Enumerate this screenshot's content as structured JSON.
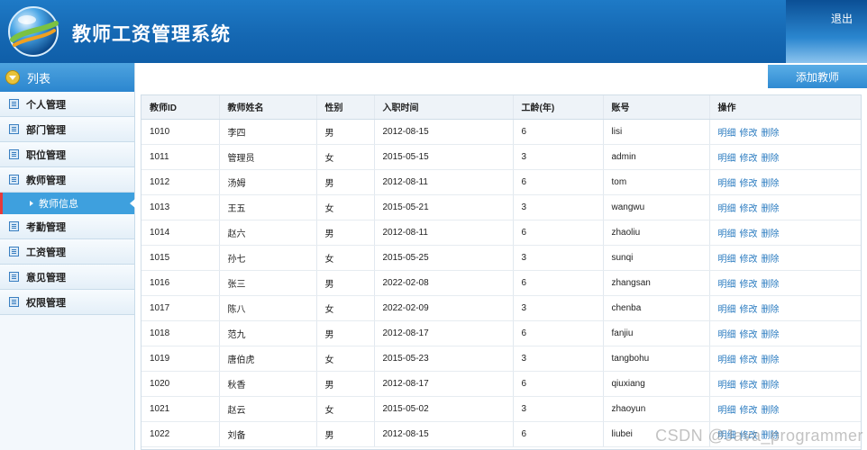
{
  "header": {
    "title": "教师工资管理系统",
    "logout_label": "退出",
    "logo_icon": "globe-logo-icon"
  },
  "sidebar": {
    "header_label": "列表",
    "items": [
      {
        "label": "个人管理"
      },
      {
        "label": "部门管理"
      },
      {
        "label": "职位管理"
      },
      {
        "label": "教师管理",
        "sub": [
          {
            "label": "教师信息",
            "active": true
          }
        ]
      },
      {
        "label": "考勤管理"
      },
      {
        "label": "工资管理"
      },
      {
        "label": "意见管理"
      },
      {
        "label": "权限管理"
      }
    ]
  },
  "toolbar": {
    "add_label": "添加教师"
  },
  "table": {
    "columns": [
      "教师ID",
      "教师姓名",
      "性别",
      "入职时间",
      "工龄(年)",
      "账号",
      "操作"
    ],
    "actions": [
      "明细",
      "修改",
      "删除"
    ],
    "rows": [
      [
        "1010",
        "李四",
        "男",
        "2012-08-15",
        "6",
        "lisi"
      ],
      [
        "1011",
        "管理员",
        "女",
        "2015-05-15",
        "3",
        "admin"
      ],
      [
        "1012",
        "汤姆",
        "男",
        "2012-08-11",
        "6",
        "tom"
      ],
      [
        "1013",
        "王五",
        "女",
        "2015-05-21",
        "3",
        "wangwu"
      ],
      [
        "1014",
        "赵六",
        "男",
        "2012-08-11",
        "6",
        "zhaoliu"
      ],
      [
        "1015",
        "孙七",
        "女",
        "2015-05-25",
        "3",
        "sunqi"
      ],
      [
        "1016",
        "张三",
        "男",
        "2022-02-08",
        "6",
        "zhangsan"
      ],
      [
        "1017",
        "陈八",
        "女",
        "2022-02-09",
        "3",
        "chenba"
      ],
      [
        "1018",
        "范九",
        "男",
        "2012-08-17",
        "6",
        "fanjiu"
      ],
      [
        "1019",
        "唐伯虎",
        "女",
        "2015-05-23",
        "3",
        "tangbohu"
      ],
      [
        "1020",
        "秋香",
        "男",
        "2012-08-17",
        "6",
        "qiuxiang"
      ],
      [
        "1021",
        "赵云",
        "女",
        "2015-05-02",
        "3",
        "zhaoyun"
      ],
      [
        "1022",
        "刘备",
        "男",
        "2012-08-15",
        "6",
        "liubei"
      ]
    ]
  },
  "watermark": "CSDN @Java_programmer",
  "colors": {
    "header_blue": "#1568b3",
    "accent_blue": "#3ea0de",
    "link_blue": "#2a7bc0",
    "active_marker": "#e63a3a"
  }
}
